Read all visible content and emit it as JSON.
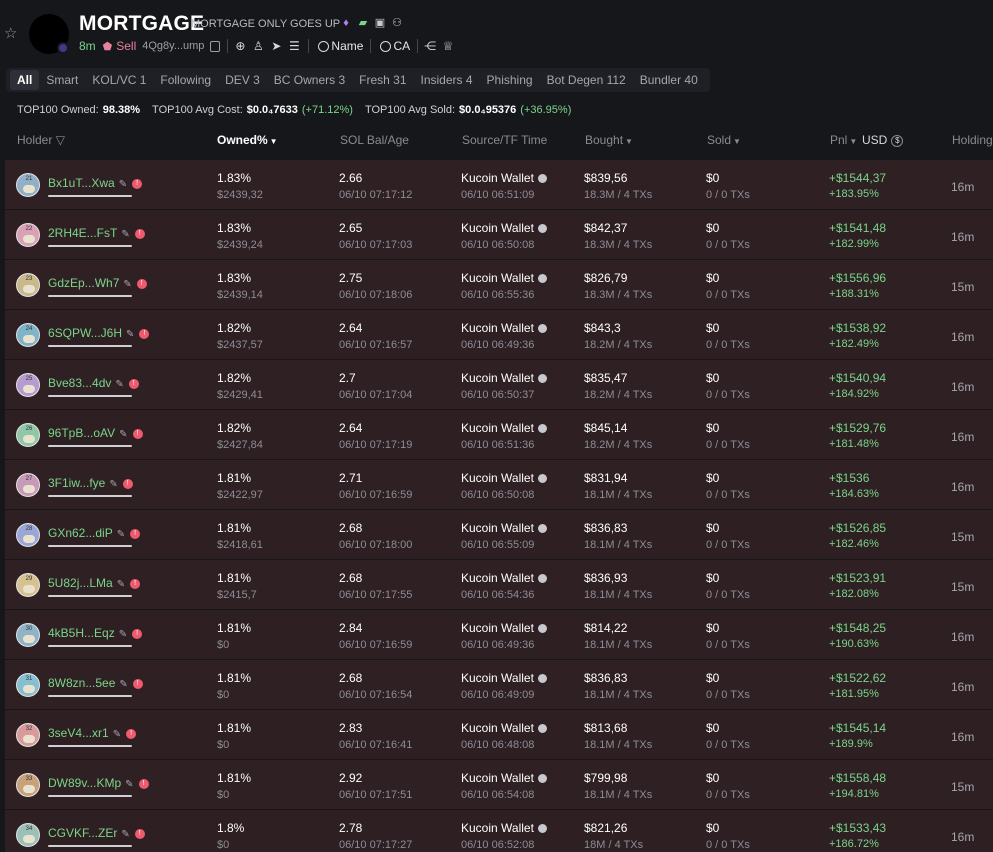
{
  "token": {
    "name": "MORTGAGE",
    "description": "MORTGAGE ONLY GOES UP",
    "age": "8m",
    "sell_label": "Sell",
    "address": "4Qg8y...ump",
    "name_search": "Name",
    "ca_search": "CA"
  },
  "tabs": [
    "All",
    "Smart",
    "KOL/VC 1",
    "Following",
    "DEV 3",
    "BC Owners 3",
    "Fresh 31",
    "Insiders 4",
    "Phishing",
    "Bot Degen 112",
    "Bundler 40"
  ],
  "stats": {
    "owned_label": "TOP100 Owned:",
    "owned_value": "98.38%",
    "avg_cost_label": "TOP100 Avg Cost:",
    "avg_cost_value": "$0.0₄7633",
    "avg_cost_change": "(+71.12%)",
    "avg_sold_label": "TOP100 Avg Sold:",
    "avg_sold_value": "$0.0₄95376",
    "avg_sold_change": "(+36.95%)"
  },
  "columns": {
    "holder": "Holder",
    "owned": "Owned%",
    "sol": "SOL Bal/Age",
    "source": "Source/TF Time",
    "bought": "Bought",
    "sold": "Sold",
    "pnl": "Pnl",
    "currency": "USD",
    "holding": "Holding"
  },
  "rows": [
    {
      "rank": "21",
      "holder": "Bx1uT...Xwa",
      "owned": "1.83%",
      "owned_usd": "$2439,32",
      "sol": "2.66",
      "age": "06/10 07:17:12",
      "source": "Kucoin Wallet",
      "tf_time": "06/10 06:51:09",
      "bought": "$839,56",
      "bought_sub": "18.3M / 4 TXs",
      "sold": "$0",
      "sold_sub": "0 / 0 TXs",
      "pnl": "+$1544,37",
      "pnl_pct": "+183.95%",
      "holding": "16m"
    },
    {
      "rank": "22",
      "holder": "2RH4E...FsT",
      "owned": "1.83%",
      "owned_usd": "$2439,24",
      "sol": "2.65",
      "age": "06/10 07:17:03",
      "source": "Kucoin Wallet",
      "tf_time": "06/10 06:50:08",
      "bought": "$842,37",
      "bought_sub": "18.3M / 4 TXs",
      "sold": "$0",
      "sold_sub": "0 / 0 TXs",
      "pnl": "+$1541,48",
      "pnl_pct": "+182.99%",
      "holding": "16m"
    },
    {
      "rank": "23",
      "holder": "GdzEp...Wh7",
      "owned": "1.83%",
      "owned_usd": "$2439,14",
      "sol": "2.75",
      "age": "06/10 07:18:06",
      "source": "Kucoin Wallet",
      "tf_time": "06/10 06:55:36",
      "bought": "$826,79",
      "bought_sub": "18.3M / 4 TXs",
      "sold": "$0",
      "sold_sub": "0 / 0 TXs",
      "pnl": "+$1556,96",
      "pnl_pct": "+188.31%",
      "holding": "15m"
    },
    {
      "rank": "24",
      "holder": "6SQPW...J6H",
      "owned": "1.82%",
      "owned_usd": "$2437,57",
      "sol": "2.64",
      "age": "06/10 07:16:57",
      "source": "Kucoin Wallet",
      "tf_time": "06/10 06:49:36",
      "bought": "$843,3",
      "bought_sub": "18.2M / 4 TXs",
      "sold": "$0",
      "sold_sub": "0 / 0 TXs",
      "pnl": "+$1538,92",
      "pnl_pct": "+182.49%",
      "holding": "16m"
    },
    {
      "rank": "25",
      "holder": "Bve83...4dv",
      "owned": "1.82%",
      "owned_usd": "$2429,41",
      "sol": "2.7",
      "age": "06/10 07:17:04",
      "source": "Kucoin Wallet",
      "tf_time": "06/10 06:50:37",
      "bought": "$835,47",
      "bought_sub": "18.2M / 4 TXs",
      "sold": "$0",
      "sold_sub": "0 / 0 TXs",
      "pnl": "+$1540,94",
      "pnl_pct": "+184.92%",
      "holding": "16m"
    },
    {
      "rank": "26",
      "holder": "96TpB...oAV",
      "owned": "1.82%",
      "owned_usd": "$2427,84",
      "sol": "2.64",
      "age": "06/10 07:17:19",
      "source": "Kucoin Wallet",
      "tf_time": "06/10 06:51:36",
      "bought": "$845,14",
      "bought_sub": "18.2M / 4 TXs",
      "sold": "$0",
      "sold_sub": "0 / 0 TXs",
      "pnl": "+$1529,76",
      "pnl_pct": "+181.48%",
      "holding": "16m"
    },
    {
      "rank": "27",
      "holder": "3F1iw...fye",
      "owned": "1.81%",
      "owned_usd": "$2422,97",
      "sol": "2.71",
      "age": "06/10 07:16:59",
      "source": "Kucoin Wallet",
      "tf_time": "06/10 06:50:08",
      "bought": "$831,94",
      "bought_sub": "18.1M / 4 TXs",
      "sold": "$0",
      "sold_sub": "0 / 0 TXs",
      "pnl": "+$1536",
      "pnl_pct": "+184.63%",
      "holding": "16m"
    },
    {
      "rank": "28",
      "holder": "GXn62...diP",
      "owned": "1.81%",
      "owned_usd": "$2418,61",
      "sol": "2.68",
      "age": "06/10 07:18:00",
      "source": "Kucoin Wallet",
      "tf_time": "06/10 06:55:09",
      "bought": "$836,83",
      "bought_sub": "18.1M / 4 TXs",
      "sold": "$0",
      "sold_sub": "0 / 0 TXs",
      "pnl": "+$1526,85",
      "pnl_pct": "+182.46%",
      "holding": "15m"
    },
    {
      "rank": "29",
      "holder": "5U82j...LMa",
      "owned": "1.81%",
      "owned_usd": "$2415,7",
      "sol": "2.68",
      "age": "06/10 07:17:55",
      "source": "Kucoin Wallet",
      "tf_time": "06/10 06:54:36",
      "bought": "$836,93",
      "bought_sub": "18.1M / 4 TXs",
      "sold": "$0",
      "sold_sub": "0 / 0 TXs",
      "pnl": "+$1523,91",
      "pnl_pct": "+182.08%",
      "holding": "15m"
    },
    {
      "rank": "30",
      "holder": "4kB5H...Eqz",
      "owned": "1.81%",
      "owned_usd": "$0",
      "sol": "2.84",
      "age": "06/10 07:16:59",
      "source": "Kucoin Wallet",
      "tf_time": "06/10 06:49:36",
      "bought": "$814,22",
      "bought_sub": "18.1M / 4 TXs",
      "sold": "$0",
      "sold_sub": "0 / 0 TXs",
      "pnl": "+$1548,25",
      "pnl_pct": "+190.63%",
      "holding": "16m"
    },
    {
      "rank": "31",
      "holder": "8W8zn...5ee",
      "owned": "1.81%",
      "owned_usd": "$0",
      "sol": "2.68",
      "age": "06/10 07:16:54",
      "source": "Kucoin Wallet",
      "tf_time": "06/10 06:49:09",
      "bought": "$836,83",
      "bought_sub": "18.1M / 4 TXs",
      "sold": "$0",
      "sold_sub": "0 / 0 TXs",
      "pnl": "+$1522,62",
      "pnl_pct": "+181.95%",
      "holding": "16m"
    },
    {
      "rank": "32",
      "holder": "3seV4...xr1",
      "owned": "1.81%",
      "owned_usd": "$0",
      "sol": "2.83",
      "age": "06/10 07:16:41",
      "source": "Kucoin Wallet",
      "tf_time": "06/10 06:48:08",
      "bought": "$813,68",
      "bought_sub": "18.1M / 4 TXs",
      "sold": "$0",
      "sold_sub": "0 / 0 TXs",
      "pnl": "+$1545,14",
      "pnl_pct": "+189.9%",
      "holding": "16m"
    },
    {
      "rank": "33",
      "holder": "DW89v...KMp",
      "owned": "1.81%",
      "owned_usd": "$0",
      "sol": "2.92",
      "age": "06/10 07:17:51",
      "source": "Kucoin Wallet",
      "tf_time": "06/10 06:54:08",
      "bought": "$799,98",
      "bought_sub": "18.1M / 4 TXs",
      "sold": "$0",
      "sold_sub": "0 / 0 TXs",
      "pnl": "+$1558,48",
      "pnl_pct": "+194.81%",
      "holding": "15m"
    },
    {
      "rank": "34",
      "holder": "CGVKF...ZEr",
      "owned": "1.8%",
      "owned_usd": "$0",
      "sol": "2.78",
      "age": "06/10 07:17:27",
      "source": "Kucoin Wallet",
      "tf_time": "06/10 06:52:08",
      "bought": "$821,26",
      "bought_sub": "18M / 4 TXs",
      "sold": "$0",
      "sold_sub": "0 / 0 TXs",
      "pnl": "+$1533,43",
      "pnl_pct": "+186.72%",
      "holding": "16m"
    }
  ]
}
